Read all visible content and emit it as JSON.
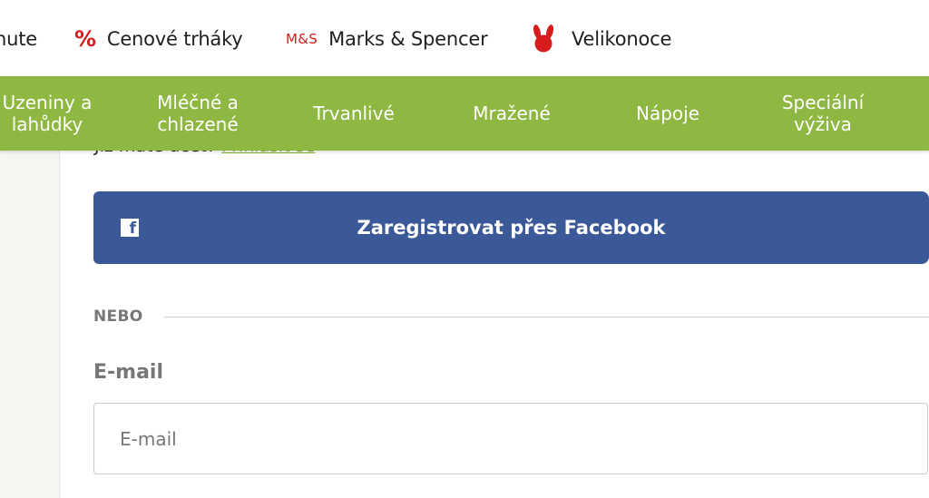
{
  "top_links": [
    {
      "label": "hute",
      "icon": null
    },
    {
      "label": "Cenové trháky",
      "icon": "percent-icon",
      "icon_text": "%"
    },
    {
      "label": "Marks & Spencer",
      "icon": "marks-spencer-logo-icon",
      "icon_text": "M&S"
    },
    {
      "label": "Velikonoce",
      "icon": "easter-bunny-icon"
    }
  ],
  "category_nav": [
    {
      "label": "Uzeniny a\nlahůdky"
    },
    {
      "label": "Mléčné a\nchlazené"
    },
    {
      "label": "Trvanlivé"
    },
    {
      "label": "Mražené"
    },
    {
      "label": "Nápoje"
    },
    {
      "label": "Speciální\nvýživa"
    }
  ],
  "login_hint": {
    "text": "Již máte účet? ",
    "link": "Přihlásit se"
  },
  "facebook_button": {
    "label": "Zaregistrovat přes Facebook",
    "icon_text": "f"
  },
  "divider": {
    "text": "NEBO"
  },
  "email": {
    "label": "E-mail",
    "value": "",
    "placeholder": "E-mail"
  },
  "colors": {
    "nav_green": "#8fb842",
    "facebook_blue": "#3b5998",
    "accent_red": "#d61c1c",
    "link_green": "#7fae2e",
    "label_gray": "#777777"
  }
}
